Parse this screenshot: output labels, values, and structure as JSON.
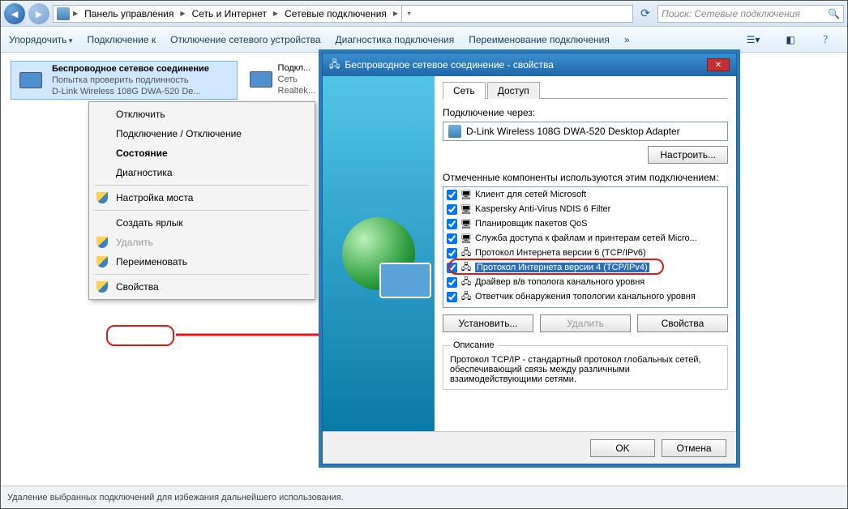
{
  "breadcrumb": {
    "seg1": "Панель управления",
    "seg2": "Сеть и Интернет",
    "seg3": "Сетевые подключения"
  },
  "search": {
    "placeholder": "Поиск: Сетевые подключения"
  },
  "toolbar": {
    "organize": "Упорядочить",
    "connect": "Подключение к",
    "disable": "Отключение сетевого устройства",
    "diag": "Диагностика подключения",
    "rename": "Переименование подключения",
    "more": "»"
  },
  "connections": {
    "wireless": {
      "title": "Беспроводное сетевое соединение",
      "line2": "Попытка проверить подлинность",
      "line3": "D-Link Wireless 108G DWA-520 De..."
    },
    "lan": {
      "title": "Подкл...",
      "line2": "Сеть",
      "line3": "Realtek..."
    }
  },
  "context_menu": {
    "disconnect": "Отключить",
    "connect_disconnect": "Подключение / Отключение",
    "state": "Состояние",
    "diag": "Диагностика",
    "bridge": "Настройка моста",
    "shortcut": "Создать ярлык",
    "delete": "Удалить",
    "rename": "Переименовать",
    "properties": "Свойства"
  },
  "dialog": {
    "title": "Беспроводное сетевое соединение - свойства",
    "tab_net": "Сеть",
    "tab_access": "Доступ",
    "connect_via": "Подключение через:",
    "adapter": "D-Link Wireless 108G DWA-520 Desktop Adapter",
    "configure": "Настроить...",
    "components_label": "Отмеченные компоненты используются этим подключением:",
    "components": [
      "Клиент для сетей Microsoft",
      "Kaspersky Anti-Virus NDIS 6 Filter",
      "Планировщик пакетов QoS",
      "Служба доступа к файлам и принтерам сетей Micro...",
      "Протокол Интернета версии 6 (TCP/IPv6)",
      "Протокол Интернета версии 4 (TCP/IPv4)",
      "Драйвер в/в тополога канального уровня",
      "Ответчик обнаружения топологии канального уровня"
    ],
    "install": "Установить...",
    "uninstall": "Удалить",
    "props": "Свойства",
    "desc_legend": "Описание",
    "desc": "Протокол TCP/IP - стандартный протокол глобальных сетей, обеспечивающий связь между различными взаимодействующими сетями.",
    "ok": "OK",
    "cancel": "Отмена"
  },
  "status_bar": "Удаление выбранных подключений для избежания дальнейшего использования."
}
